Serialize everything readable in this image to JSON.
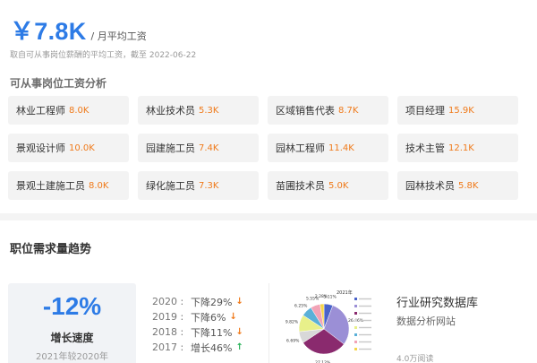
{
  "salary": {
    "value": "￥7.8K",
    "unit": "/ 月平均工资",
    "note": "取自可从事岗位薪酬的平均工资，截至 2022-06-22"
  },
  "analysis": {
    "title": "可从事岗位工资分析",
    "jobs": [
      {
        "name": "林业工程师",
        "salary": "8.0K"
      },
      {
        "name": "林业技术员",
        "salary": "5.3K"
      },
      {
        "name": "区域销售代表",
        "salary": "8.7K"
      },
      {
        "name": "项目经理",
        "salary": "15.9K"
      },
      {
        "name": "景观设计师",
        "salary": "10.0K"
      },
      {
        "name": "园建施工员",
        "salary": "7.4K"
      },
      {
        "name": "园林工程师",
        "salary": "11.4K"
      },
      {
        "name": "技术主管",
        "salary": "12.1K"
      },
      {
        "name": "景观土建施工员",
        "salary": "8.0K"
      },
      {
        "name": "绿化施工员",
        "salary": "7.3K"
      },
      {
        "name": "苗圃技术员",
        "salary": "5.0K"
      },
      {
        "name": "园林技术员",
        "salary": "5.8K"
      }
    ]
  },
  "demand": {
    "title": "职位需求量趋势",
    "growth_pct": "-12%",
    "growth_label": "增长速度",
    "growth_sub": "2021年较2020年",
    "trends": [
      {
        "year": "2020 :",
        "text": "下降29%",
        "dir": "down"
      },
      {
        "year": "2019 :",
        "text": "下降6%",
        "dir": "down"
      },
      {
        "year": "2018 :",
        "text": "下降11%",
        "dir": "down"
      },
      {
        "year": "2017 :",
        "text": "增长46%",
        "dir": "up"
      }
    ]
  },
  "ad": {
    "title": "行业研究数据库",
    "subtitle": "数据分析网站",
    "views": "4.0万阅读"
  },
  "icons": {
    "down": "arrow-down-icon",
    "up": "arrow-up-icon"
  },
  "colors": {
    "accent": "#2d7be6",
    "salary": "#f07a1a",
    "up": "#2bb35a"
  },
  "chart_data": {
    "type": "pie",
    "title": "2021年",
    "slice_labels": [
      "5.11%",
      "26.46%",
      "27.12%",
      "6.69%",
      "9.82%",
      "6.25%",
      "5.55%",
      "2.28%"
    ],
    "values": [
      5.11,
      26.46,
      27.12,
      6.69,
      9.82,
      6.25,
      5.55,
      2.28
    ],
    "colors": [
      "#4a63c9",
      "#9b8fd6",
      "#8a2a6e",
      "#d8d8d8",
      "#e8f08a",
      "#5ab0d8",
      "#f2a3b6",
      "#f5d54a"
    ]
  }
}
